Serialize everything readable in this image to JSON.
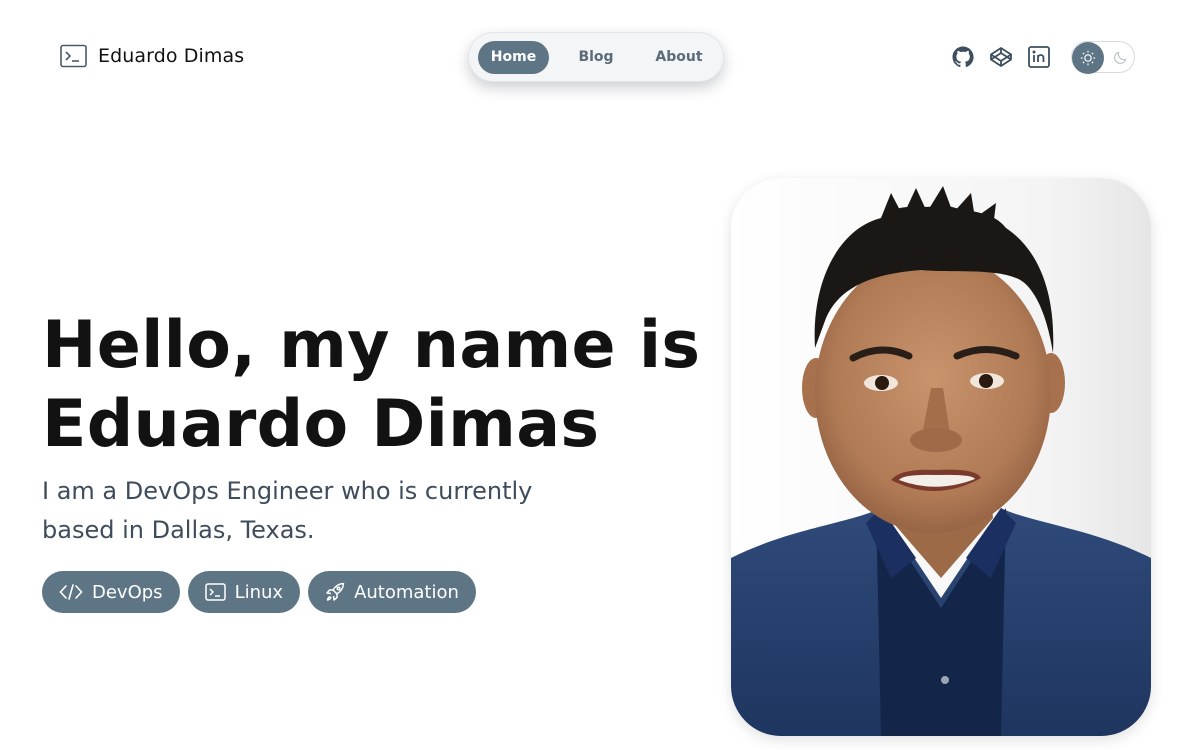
{
  "header": {
    "brand_name": "Eduardo Dimas",
    "brand_icon": "terminal-icon",
    "nav": [
      {
        "label": "Home",
        "active": true
      },
      {
        "label": "Blog",
        "active": false
      },
      {
        "label": "About",
        "active": false
      }
    ],
    "social_icons": [
      "github-icon",
      "codepen-icon",
      "linkedin-icon"
    ],
    "theme_toggle": {
      "mode": "light",
      "icons": [
        "sun-icon",
        "moon-icon"
      ]
    }
  },
  "hero": {
    "headline_line1": "Hello, my name is",
    "headline_line2": "Eduardo Dimas",
    "subtitle_line1": "I am a DevOps Engineer who is currently",
    "subtitle_line2": "based in Dallas, Texas.",
    "tags": [
      {
        "label": "DevOps",
        "icon": "code-icon"
      },
      {
        "label": "Linux",
        "icon": "terminal-icon"
      },
      {
        "label": "Automation",
        "icon": "rocket-icon"
      }
    ]
  },
  "colors": {
    "accent": "#5d7584",
    "text": "#121212",
    "subtitle": "#3f4c5c"
  }
}
